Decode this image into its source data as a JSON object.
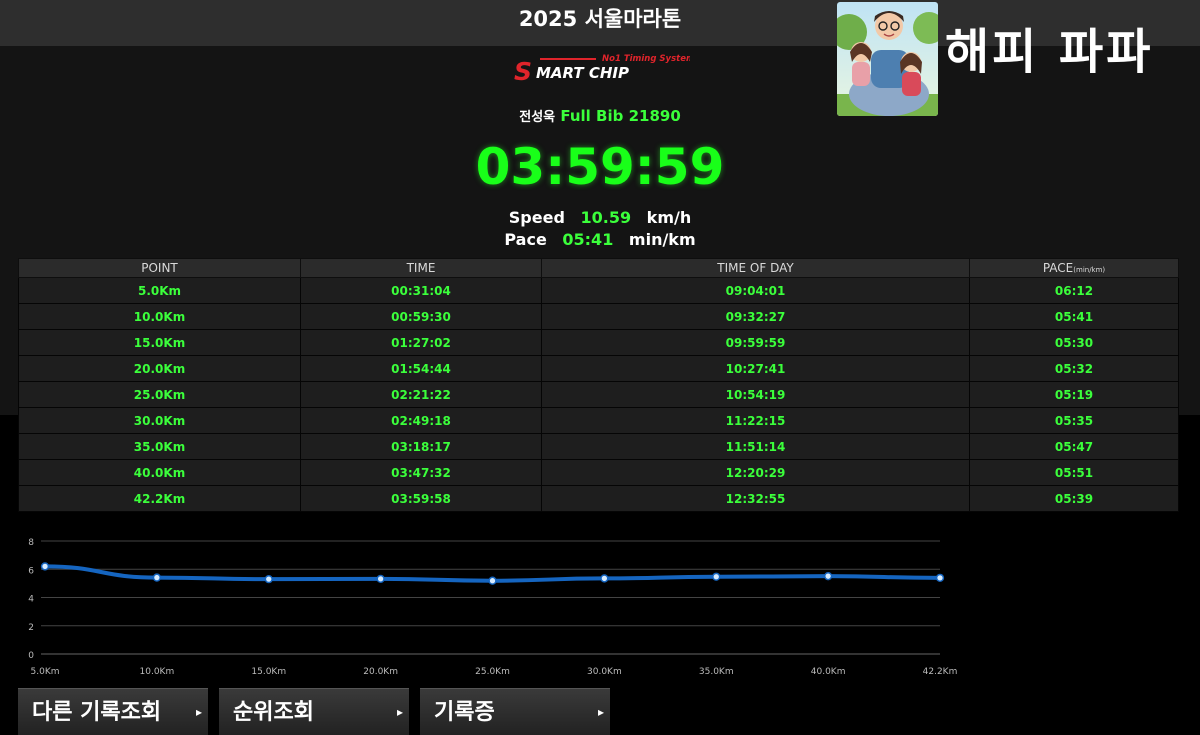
{
  "header": {
    "title": "2025 서울마라톤"
  },
  "channel": {
    "name": "해피 파파"
  },
  "logo": {
    "tagline": "No1 Timing System",
    "brand_s": "S",
    "brand_rest": "MART CHIP"
  },
  "runner": {
    "name": "전성욱",
    "bib": "Full Bib 21890"
  },
  "result": {
    "finish_time": "03:59:59",
    "speed_label": "Speed",
    "speed_value": "10.59",
    "speed_unit": "km/h",
    "pace_label": "Pace",
    "pace_value": "05:41",
    "pace_unit": "min/km"
  },
  "table": {
    "headers": {
      "point": "POINT",
      "time": "TIME",
      "time_of_day": "TIME OF DAY",
      "pace": "PACE",
      "pace_unit": "(min/km)"
    },
    "rows": [
      {
        "point": "5.0Km",
        "time": "00:31:04",
        "tod": "09:04:01",
        "pace": "06:12"
      },
      {
        "point": "10.0Km",
        "time": "00:59:30",
        "tod": "09:32:27",
        "pace": "05:41"
      },
      {
        "point": "15.0Km",
        "time": "01:27:02",
        "tod": "09:59:59",
        "pace": "05:30"
      },
      {
        "point": "20.0Km",
        "time": "01:54:44",
        "tod": "10:27:41",
        "pace": "05:32"
      },
      {
        "point": "25.0Km",
        "time": "02:21:22",
        "tod": "10:54:19",
        "pace": "05:19"
      },
      {
        "point": "30.0Km",
        "time": "02:49:18",
        "tod": "11:22:15",
        "pace": "05:35"
      },
      {
        "point": "35.0Km",
        "time": "03:18:17",
        "tod": "11:51:14",
        "pace": "05:47"
      },
      {
        "point": "40.0Km",
        "time": "03:47:32",
        "tod": "12:20:29",
        "pace": "05:51"
      },
      {
        "point": "42.2Km",
        "time": "03:59:58",
        "tod": "12:32:55",
        "pace": "05:39"
      }
    ]
  },
  "chart_data": {
    "type": "line",
    "categories": [
      "5.0Km",
      "10.0Km",
      "15.0Km",
      "20.0Km",
      "25.0Km",
      "30.0Km",
      "35.0Km",
      "40.0Km",
      "42.2Km"
    ],
    "series": [
      {
        "values": [
          6.2,
          5.41,
          5.3,
          5.32,
          5.19,
          5.35,
          5.47,
          5.51,
          5.39
        ]
      }
    ],
    "yticks": [
      0,
      2,
      4,
      6,
      8
    ],
    "ylim": [
      0,
      8
    ],
    "grid": true,
    "line_color": "#1565c0"
  },
  "buttons": {
    "other_record": "다른 기록조회",
    "ranking": "순위조회",
    "certificate": "기록증",
    "arrow": "▸"
  }
}
